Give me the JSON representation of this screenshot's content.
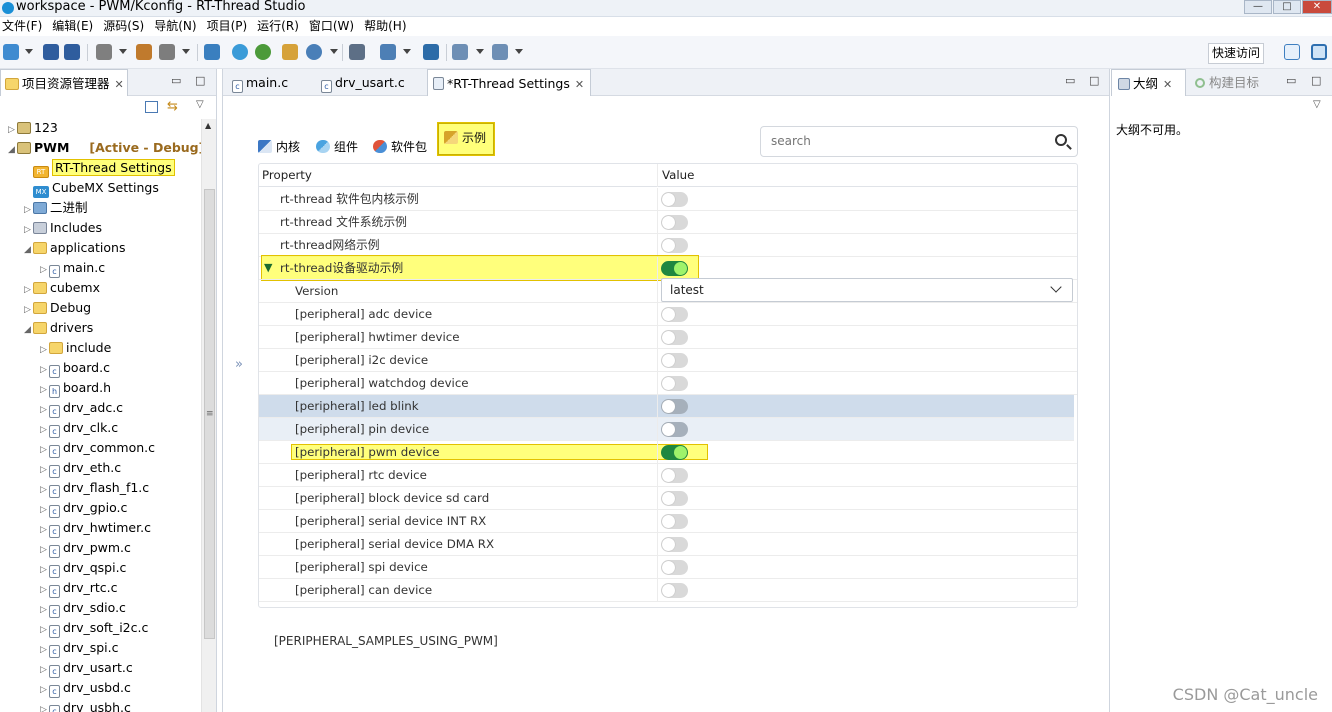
{
  "window": {
    "title": "workspace - PWM/Kconfig - RT-Thread Studio"
  },
  "menu": [
    "文件(F)",
    "编辑(E)",
    "源码(S)",
    "导航(N)",
    "项目(P)",
    "运行(R)",
    "窗口(W)",
    "帮助(H)"
  ],
  "toolbar": {
    "quick_access": "快速访问"
  },
  "explorer": {
    "tab_label": "项目资源管理器",
    "items": [
      {
        "label": "123",
        "type": "project",
        "twisty": "▷",
        "indent": 0
      },
      {
        "label": "PWM",
        "type": "project",
        "twisty": "◢",
        "indent": 0,
        "bold": true,
        "suffix": "[Active - Debug]"
      },
      {
        "label": "RT-Thread Settings",
        "type": "rt",
        "twisty": "",
        "indent": 1,
        "highlight": true
      },
      {
        "label": "CubeMX Settings",
        "type": "mx",
        "twisty": "",
        "indent": 1
      },
      {
        "label": "二进制",
        "type": "bin",
        "twisty": "▷",
        "indent": 1
      },
      {
        "label": "Includes",
        "type": "inc",
        "twisty": "▷",
        "indent": 1
      },
      {
        "label": "applications",
        "type": "folder",
        "twisty": "◢",
        "indent": 1
      },
      {
        "label": "main.c",
        "type": "cfile",
        "twisty": "▷",
        "indent": 2
      },
      {
        "label": "cubemx",
        "type": "folder",
        "twisty": "▷",
        "indent": 1
      },
      {
        "label": "Debug",
        "type": "folder",
        "twisty": "▷",
        "indent": 1
      },
      {
        "label": "drivers",
        "type": "folder",
        "twisty": "◢",
        "indent": 1
      },
      {
        "label": "include",
        "type": "folder",
        "twisty": "▷",
        "indent": 2
      },
      {
        "label": "board.c",
        "type": "cfile",
        "twisty": "▷",
        "indent": 2
      },
      {
        "label": "board.h",
        "type": "hfile",
        "twisty": "▷",
        "indent": 2
      },
      {
        "label": "drv_adc.c",
        "type": "cfile",
        "twisty": "▷",
        "indent": 2
      },
      {
        "label": "drv_clk.c",
        "type": "cfile",
        "twisty": "▷",
        "indent": 2
      },
      {
        "label": "drv_common.c",
        "type": "cfile",
        "twisty": "▷",
        "indent": 2
      },
      {
        "label": "drv_eth.c",
        "type": "cfile",
        "twisty": "▷",
        "indent": 2
      },
      {
        "label": "drv_flash_f1.c",
        "type": "cfile",
        "twisty": "▷",
        "indent": 2
      },
      {
        "label": "drv_gpio.c",
        "type": "cfile",
        "twisty": "▷",
        "indent": 2
      },
      {
        "label": "drv_hwtimer.c",
        "type": "cfile",
        "twisty": "▷",
        "indent": 2
      },
      {
        "label": "drv_pwm.c",
        "type": "cfile",
        "twisty": "▷",
        "indent": 2
      },
      {
        "label": "drv_qspi.c",
        "type": "cfile",
        "twisty": "▷",
        "indent": 2
      },
      {
        "label": "drv_rtc.c",
        "type": "cfile",
        "twisty": "▷",
        "indent": 2
      },
      {
        "label": "drv_sdio.c",
        "type": "cfile",
        "twisty": "▷",
        "indent": 2
      },
      {
        "label": "drv_soft_i2c.c",
        "type": "cfile",
        "twisty": "▷",
        "indent": 2
      },
      {
        "label": "drv_spi.c",
        "type": "cfile",
        "twisty": "▷",
        "indent": 2
      },
      {
        "label": "drv_usart.c",
        "type": "cfile",
        "twisty": "▷",
        "indent": 2
      },
      {
        "label": "drv_usbd.c",
        "type": "cfile",
        "twisty": "▷",
        "indent": 2
      },
      {
        "label": "drv_usbh.c",
        "type": "cfile",
        "twisty": "▷",
        "indent": 2
      }
    ]
  },
  "editor": {
    "tabs": [
      {
        "label": "main.c",
        "active": false
      },
      {
        "label": "drv_usart.c",
        "active": false
      },
      {
        "label": "*RT-Thread Settings",
        "active": true
      }
    ]
  },
  "settings": {
    "tabs": [
      {
        "label": "内核",
        "icon": "kernel-icon"
      },
      {
        "label": "组件",
        "icon": "component-icon"
      },
      {
        "label": "软件包",
        "icon": "package-icon"
      },
      {
        "label": "示例",
        "icon": "sample-icon",
        "active": true
      }
    ],
    "search_placeholder": "search",
    "columns": {
      "property": "Property",
      "value": "Value"
    },
    "rows": [
      {
        "label": "rt-thread 软件包内核示例",
        "indent": 1,
        "kind": "toggle",
        "on": false
      },
      {
        "label": "rt-thread 文件系统示例",
        "indent": 1,
        "kind": "toggle",
        "on": false
      },
      {
        "label": "rt-thread网络示例",
        "indent": 1,
        "kind": "toggle",
        "on": false
      },
      {
        "label": "rt-thread设备驱动示例",
        "indent": 1,
        "kind": "toggle",
        "on": true,
        "expanded": true,
        "highlight": true
      },
      {
        "label": "Version",
        "indent": 2,
        "kind": "select",
        "value": "latest"
      },
      {
        "label": "[peripheral] adc device",
        "indent": 2,
        "kind": "toggle",
        "on": false
      },
      {
        "label": "[peripheral] hwtimer device",
        "indent": 2,
        "kind": "toggle",
        "on": false
      },
      {
        "label": "[peripheral] i2c device",
        "indent": 2,
        "kind": "toggle",
        "on": false
      },
      {
        "label": "[peripheral] watchdog device",
        "indent": 2,
        "kind": "toggle",
        "on": false
      },
      {
        "label": "[peripheral] led blink",
        "indent": 2,
        "kind": "toggle",
        "on": false,
        "selected": true
      },
      {
        "label": "[peripheral] pin device",
        "indent": 2,
        "kind": "toggle",
        "on": false,
        "hover": true
      },
      {
        "label": "[peripheral] pwm device",
        "indent": 2,
        "kind": "toggle",
        "on": true,
        "highlight": true
      },
      {
        "label": "[peripheral] rtc device",
        "indent": 2,
        "kind": "toggle",
        "on": false
      },
      {
        "label": "[peripheral] block device sd card",
        "indent": 2,
        "kind": "toggle",
        "on": false
      },
      {
        "label": "[peripheral] serial device INT RX",
        "indent": 2,
        "kind": "toggle",
        "on": false
      },
      {
        "label": "[peripheral] serial device DMA RX",
        "indent": 2,
        "kind": "toggle",
        "on": false
      },
      {
        "label": "[peripheral] spi device",
        "indent": 2,
        "kind": "toggle",
        "on": false
      },
      {
        "label": "[peripheral] can device",
        "indent": 2,
        "kind": "toggle",
        "on": false
      }
    ],
    "macro": "[PERIPHERAL_SAMPLES_USING_PWM]"
  },
  "outline": {
    "tab_label": "大纲",
    "tab2_label": "构建目标",
    "message": "大纲不可用。"
  },
  "watermark": "CSDN @Cat_uncle",
  "colors": {
    "highlight": "#ffff7a",
    "toggle_on": "#1f8740",
    "selected_row": "#cfdceb"
  }
}
